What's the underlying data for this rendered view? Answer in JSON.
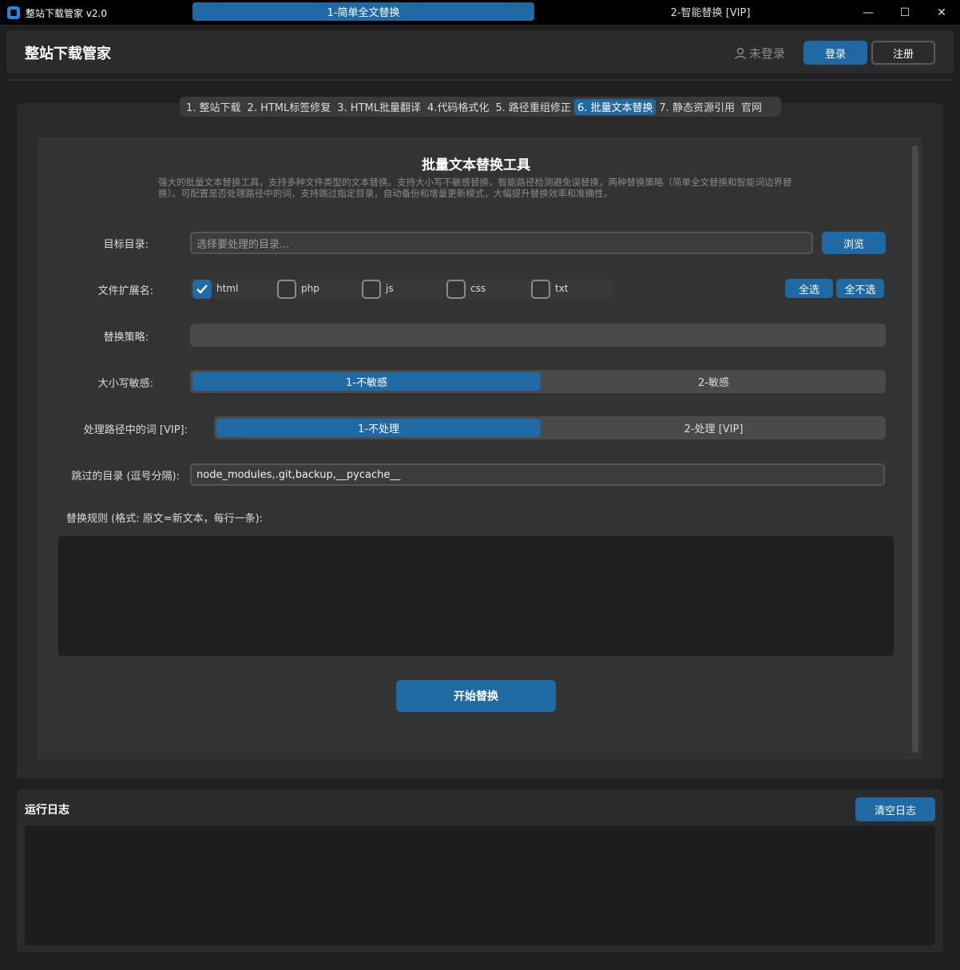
{
  "window": {
    "title": "整站下载管家 v2.0",
    "minimize": "—",
    "maximize": "☐",
    "close": "✕"
  },
  "header": {
    "brand": "整站下载管家",
    "login_status": "未登录",
    "login_label": "登录",
    "register_label": "注册"
  },
  "tabs": [
    {
      "label": "1. 整站下载"
    },
    {
      "label": "2. HTML标签修复"
    },
    {
      "label": "3. HTML批量翻译"
    },
    {
      "label": "4.代码格式化"
    },
    {
      "label": "5. 路径重组修正"
    },
    {
      "label": "6. 批量文本替换",
      "active": true
    },
    {
      "label": "7. 静态资源引用"
    },
    {
      "label": "官网"
    }
  ],
  "tool": {
    "title": "批量文本替换工具",
    "description": "强大的批量文本替换工具，支持多种文件类型的文本替换。支持大小写不敏感替换，智能路径检测避免误替换，两种替换策略（简单全文替换和智能词边界替换）。可配置是否处理路径中的词，支持跳过指定目录，自动备份和增量更新模式，大幅提升替换效率和准确性。"
  },
  "form": {
    "target_dir_label": "目标目录:",
    "target_dir_placeholder": "选择要处理的目录...",
    "browse_label": "浏览",
    "ext_label": "文件扩展名:",
    "extensions": [
      {
        "name": "html",
        "checked": true
      },
      {
        "name": "php",
        "checked": false
      },
      {
        "name": "js",
        "checked": false
      },
      {
        "name": "css",
        "checked": false
      },
      {
        "name": "txt",
        "checked": false
      }
    ],
    "select_all_label": "全选",
    "select_none_label": "全不选",
    "strategy_label": "替换策略:",
    "strategy_options": [
      "1-简单全文替换",
      "2-智能替换 [VIP]"
    ],
    "case_label": "大小写敏感:",
    "case_options": [
      "1-不敏感",
      "2-敏感"
    ],
    "path_label": "处理路径中的词 [VIP]:",
    "path_options": [
      "1-不处理",
      "2-处理 [VIP]"
    ],
    "skip_label": "跳过的目录 (逗号分隔):",
    "skip_value": "node_modules,.git,backup,__pycache__",
    "rules_label": "替换规则 (格式: 原文=新文本，每行一条):",
    "start_label": "开始替换"
  },
  "log": {
    "title": "运行日志",
    "clear_label": "清空日志"
  },
  "colors": {
    "accent": "#1f6aa5",
    "bg": "#1f1f1f",
    "panel": "#2b2b2b"
  }
}
